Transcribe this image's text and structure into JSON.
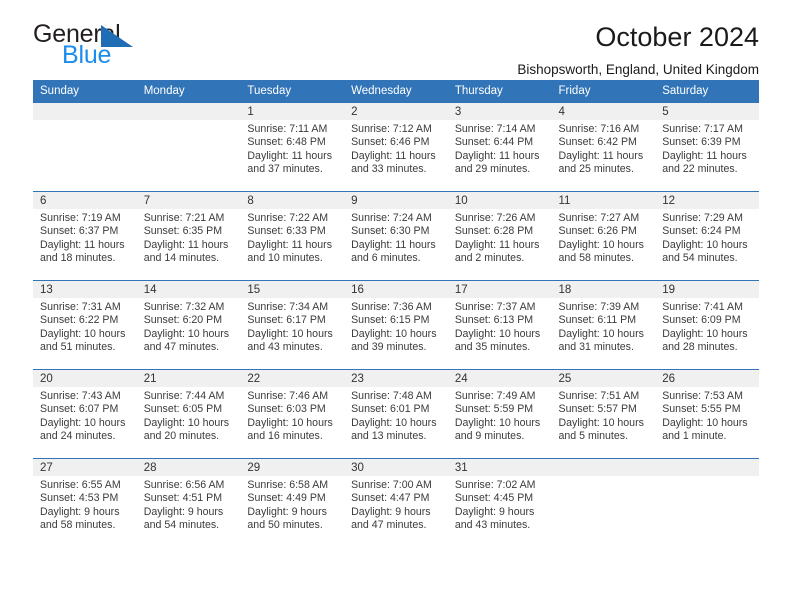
{
  "brand": {
    "word1": "General",
    "word2": "Blue",
    "triangle_color": "#1f6db5",
    "blue_text_color": "#1b8ceb"
  },
  "header": {
    "title": "October 2024",
    "location": "Bishopsworth, England, United Kingdom",
    "accent_color": "#3274b8",
    "daynum_band_color": "#f0f0f0"
  },
  "weekday_headers": [
    "Sunday",
    "Monday",
    "Tuesday",
    "Wednesday",
    "Thursday",
    "Friday",
    "Saturday"
  ],
  "weeks": [
    [
      {
        "empty": true
      },
      {
        "empty": true
      },
      {
        "day": "1",
        "sunrise": "Sunrise: 7:11 AM",
        "sunset": "Sunset: 6:48 PM",
        "daylight1": "Daylight: 11 hours",
        "daylight2": "and 37 minutes."
      },
      {
        "day": "2",
        "sunrise": "Sunrise: 7:12 AM",
        "sunset": "Sunset: 6:46 PM",
        "daylight1": "Daylight: 11 hours",
        "daylight2": "and 33 minutes."
      },
      {
        "day": "3",
        "sunrise": "Sunrise: 7:14 AM",
        "sunset": "Sunset: 6:44 PM",
        "daylight1": "Daylight: 11 hours",
        "daylight2": "and 29 minutes."
      },
      {
        "day": "4",
        "sunrise": "Sunrise: 7:16 AM",
        "sunset": "Sunset: 6:42 PM",
        "daylight1": "Daylight: 11 hours",
        "daylight2": "and 25 minutes."
      },
      {
        "day": "5",
        "sunrise": "Sunrise: 7:17 AM",
        "sunset": "Sunset: 6:39 PM",
        "daylight1": "Daylight: 11 hours",
        "daylight2": "and 22 minutes."
      }
    ],
    [
      {
        "day": "6",
        "sunrise": "Sunrise: 7:19 AM",
        "sunset": "Sunset: 6:37 PM",
        "daylight1": "Daylight: 11 hours",
        "daylight2": "and 18 minutes."
      },
      {
        "day": "7",
        "sunrise": "Sunrise: 7:21 AM",
        "sunset": "Sunset: 6:35 PM",
        "daylight1": "Daylight: 11 hours",
        "daylight2": "and 14 minutes."
      },
      {
        "day": "8",
        "sunrise": "Sunrise: 7:22 AM",
        "sunset": "Sunset: 6:33 PM",
        "daylight1": "Daylight: 11 hours",
        "daylight2": "and 10 minutes."
      },
      {
        "day": "9",
        "sunrise": "Sunrise: 7:24 AM",
        "sunset": "Sunset: 6:30 PM",
        "daylight1": "Daylight: 11 hours",
        "daylight2": "and 6 minutes."
      },
      {
        "day": "10",
        "sunrise": "Sunrise: 7:26 AM",
        "sunset": "Sunset: 6:28 PM",
        "daylight1": "Daylight: 11 hours",
        "daylight2": "and 2 minutes."
      },
      {
        "day": "11",
        "sunrise": "Sunrise: 7:27 AM",
        "sunset": "Sunset: 6:26 PM",
        "daylight1": "Daylight: 10 hours",
        "daylight2": "and 58 minutes."
      },
      {
        "day": "12",
        "sunrise": "Sunrise: 7:29 AM",
        "sunset": "Sunset: 6:24 PM",
        "daylight1": "Daylight: 10 hours",
        "daylight2": "and 54 minutes."
      }
    ],
    [
      {
        "day": "13",
        "sunrise": "Sunrise: 7:31 AM",
        "sunset": "Sunset: 6:22 PM",
        "daylight1": "Daylight: 10 hours",
        "daylight2": "and 51 minutes."
      },
      {
        "day": "14",
        "sunrise": "Sunrise: 7:32 AM",
        "sunset": "Sunset: 6:20 PM",
        "daylight1": "Daylight: 10 hours",
        "daylight2": "and 47 minutes."
      },
      {
        "day": "15",
        "sunrise": "Sunrise: 7:34 AM",
        "sunset": "Sunset: 6:17 PM",
        "daylight1": "Daylight: 10 hours",
        "daylight2": "and 43 minutes."
      },
      {
        "day": "16",
        "sunrise": "Sunrise: 7:36 AM",
        "sunset": "Sunset: 6:15 PM",
        "daylight1": "Daylight: 10 hours",
        "daylight2": "and 39 minutes."
      },
      {
        "day": "17",
        "sunrise": "Sunrise: 7:37 AM",
        "sunset": "Sunset: 6:13 PM",
        "daylight1": "Daylight: 10 hours",
        "daylight2": "and 35 minutes."
      },
      {
        "day": "18",
        "sunrise": "Sunrise: 7:39 AM",
        "sunset": "Sunset: 6:11 PM",
        "daylight1": "Daylight: 10 hours",
        "daylight2": "and 31 minutes."
      },
      {
        "day": "19",
        "sunrise": "Sunrise: 7:41 AM",
        "sunset": "Sunset: 6:09 PM",
        "daylight1": "Daylight: 10 hours",
        "daylight2": "and 28 minutes."
      }
    ],
    [
      {
        "day": "20",
        "sunrise": "Sunrise: 7:43 AM",
        "sunset": "Sunset: 6:07 PM",
        "daylight1": "Daylight: 10 hours",
        "daylight2": "and 24 minutes."
      },
      {
        "day": "21",
        "sunrise": "Sunrise: 7:44 AM",
        "sunset": "Sunset: 6:05 PM",
        "daylight1": "Daylight: 10 hours",
        "daylight2": "and 20 minutes."
      },
      {
        "day": "22",
        "sunrise": "Sunrise: 7:46 AM",
        "sunset": "Sunset: 6:03 PM",
        "daylight1": "Daylight: 10 hours",
        "daylight2": "and 16 minutes."
      },
      {
        "day": "23",
        "sunrise": "Sunrise: 7:48 AM",
        "sunset": "Sunset: 6:01 PM",
        "daylight1": "Daylight: 10 hours",
        "daylight2": "and 13 minutes."
      },
      {
        "day": "24",
        "sunrise": "Sunrise: 7:49 AM",
        "sunset": "Sunset: 5:59 PM",
        "daylight1": "Daylight: 10 hours",
        "daylight2": "and 9 minutes."
      },
      {
        "day": "25",
        "sunrise": "Sunrise: 7:51 AM",
        "sunset": "Sunset: 5:57 PM",
        "daylight1": "Daylight: 10 hours",
        "daylight2": "and 5 minutes."
      },
      {
        "day": "26",
        "sunrise": "Sunrise: 7:53 AM",
        "sunset": "Sunset: 5:55 PM",
        "daylight1": "Daylight: 10 hours",
        "daylight2": "and 1 minute."
      }
    ],
    [
      {
        "day": "27",
        "sunrise": "Sunrise: 6:55 AM",
        "sunset": "Sunset: 4:53 PM",
        "daylight1": "Daylight: 9 hours",
        "daylight2": "and 58 minutes."
      },
      {
        "day": "28",
        "sunrise": "Sunrise: 6:56 AM",
        "sunset": "Sunset: 4:51 PM",
        "daylight1": "Daylight: 9 hours",
        "daylight2": "and 54 minutes."
      },
      {
        "day": "29",
        "sunrise": "Sunrise: 6:58 AM",
        "sunset": "Sunset: 4:49 PM",
        "daylight1": "Daylight: 9 hours",
        "daylight2": "and 50 minutes."
      },
      {
        "day": "30",
        "sunrise": "Sunrise: 7:00 AM",
        "sunset": "Sunset: 4:47 PM",
        "daylight1": "Daylight: 9 hours",
        "daylight2": "and 47 minutes."
      },
      {
        "day": "31",
        "sunrise": "Sunrise: 7:02 AM",
        "sunset": "Sunset: 4:45 PM",
        "daylight1": "Daylight: 9 hours",
        "daylight2": "and 43 minutes."
      },
      {
        "empty": true
      },
      {
        "empty": true
      }
    ]
  ]
}
